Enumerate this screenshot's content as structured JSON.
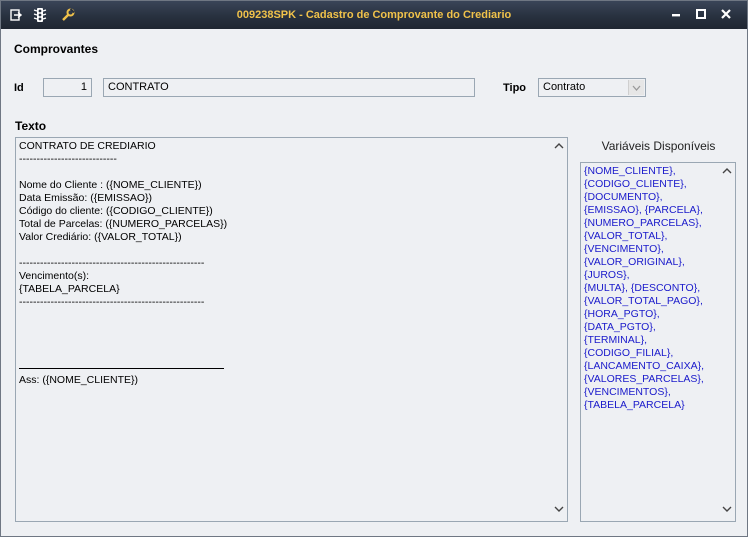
{
  "window": {
    "title": "009238SPK - Cadastro de Comprovante do Crediario",
    "icons": [
      "menu-icon",
      "traffic-light-icon",
      "wrench-icon"
    ],
    "controls": [
      "minimize-icon",
      "maximize-icon",
      "close-icon"
    ]
  },
  "section": {
    "title": "Comprovantes"
  },
  "form": {
    "id_label": "Id",
    "id_value": "1",
    "name_value": "CONTRATO",
    "tipo_label": "Tipo",
    "tipo_value": "Contrato"
  },
  "texto": {
    "label": "Texto",
    "lines": [
      "CONTRATO DE CREDIARIO",
      "----------------------------",
      "",
      "Nome do Cliente : ({NOME_CLIENTE})",
      "Data Emissão: ({EMISSAO})",
      "Código do cliente: ({CODIGO_CLIENTE})",
      "Total de Parcelas: ({NUMERO_PARCELAS})",
      "Valor Crediário: ({VALOR_TOTAL})",
      "",
      "-----------------------------------------------------",
      "Vencimento(s):",
      "{TABELA_PARCELA}",
      "-----------------------------------------------------",
      "",
      "",
      "",
      "",
      "",
      "Ass: ({NOME_CLIENTE})"
    ]
  },
  "variaveis": {
    "label": "Variáveis Disponíveis",
    "lines": [
      "{NOME_CLIENTE},",
      "{CODIGO_CLIENTE},",
      "{DOCUMENTO},",
      "{EMISSAO}, {PARCELA},",
      "{NUMERO_PARCELAS},",
      "{VALOR_TOTAL},",
      "{VENCIMENTO},",
      "{VALOR_ORIGINAL},",
      "{JUROS},",
      "{MULTA}, {DESCONTO},",
      "{VALOR_TOTAL_PAGO},",
      "{HORA_PGTO},",
      "{DATA_PGTO},",
      "{TERMINAL},",
      "{CODIGO_FILIAL},",
      "{LANCAMENTO_CAIXA},",
      "{VALORES_PARCELAS},",
      "{VENCIMENTOS},",
      "{TABELA_PARCELA}"
    ]
  }
}
